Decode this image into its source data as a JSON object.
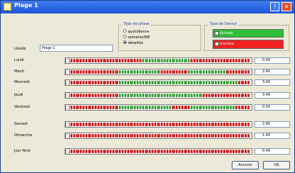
{
  "window": {
    "title": "Plage 1"
  },
  "groups": {
    "phase": {
      "title": "Type de phase",
      "options": [
        {
          "label": "quotidienne",
          "selected": false
        },
        {
          "label": "semaine/WE",
          "selected": false
        },
        {
          "label": "détaillée",
          "selected": true
        }
      ]
    },
    "device": {
      "title": "Type de Device",
      "options": [
        {
          "label": "Activée",
          "color": "#2fbf3a"
        },
        {
          "label": "Inactive",
          "color": "#f02222"
        }
      ]
    }
  },
  "name": {
    "label": "Libellé",
    "value": "Plage 1"
  },
  "days": [
    {
      "label": "Lundi",
      "value": "0.00",
      "segments": "RRRRRRRRRRRRRRRRRRRRRRRRGGGGGGGGGGGGGGGGRRRRRRRRRRRRRRRRRRRR"
    },
    {
      "label": "Mardi",
      "value": "2.40",
      "segments": "RRRRRRRRRRRRRRRRGGGGGGGGGGGGGGRRRRRRRRRGGGGGGGGGGGGGRRRRRRRR"
    },
    {
      "label": "Mercredi",
      "value": "3.00",
      "segments": "RRRRRRRRRRRRRRRRGGGGGGGGGGGGGGGGGGGGGGGGGGGGGGGGGGGGGGGGRRRR"
    },
    {
      "label": "Jeudi",
      "value": "3.40",
      "segments": "RRRRRRRRRRRRRRRRGGGGGGGGGGGGGGGGGGGGGGGGGGGGRRRRRRRRRRRRRRRR"
    },
    {
      "label": "Vendredi",
      "value": "0.50",
      "segments": "RRRRRRRRRRRRRRRRGGGGGGGGGGGGGGGGGGRRRRRRGGGGGGGGGGGGGGGRRRRR"
    },
    {
      "label": "Samedi",
      "value": "2.40",
      "segments": "RRRRRRRRRRRRRRRRRRRRRRRRRRRRRRRRRRRRRRRRRRRRRRRRRRRRRRRRRRRR"
    },
    {
      "label": "Dimanche",
      "value": "1.40",
      "segments": "RRRRRRRRRRRRRRRRRRRRRRRRRRRRRRRRRRRRRRRRRRRRRRRRRRRRRRRRRRRR"
    },
    {
      "label": "Jour férié",
      "value": "0.40",
      "segments": "RRRRRRRRRRRRRRRRRRRRRRRRRRRRRRRRRRRRRRRRRRRRRRRRRRRRRRRRRRRR"
    }
  ],
  "buttons": {
    "cancel": "Annuler",
    "ok": "OK"
  },
  "icons": {
    "window": "calendar-icon",
    "help": "help-icon",
    "close": "close-icon"
  }
}
